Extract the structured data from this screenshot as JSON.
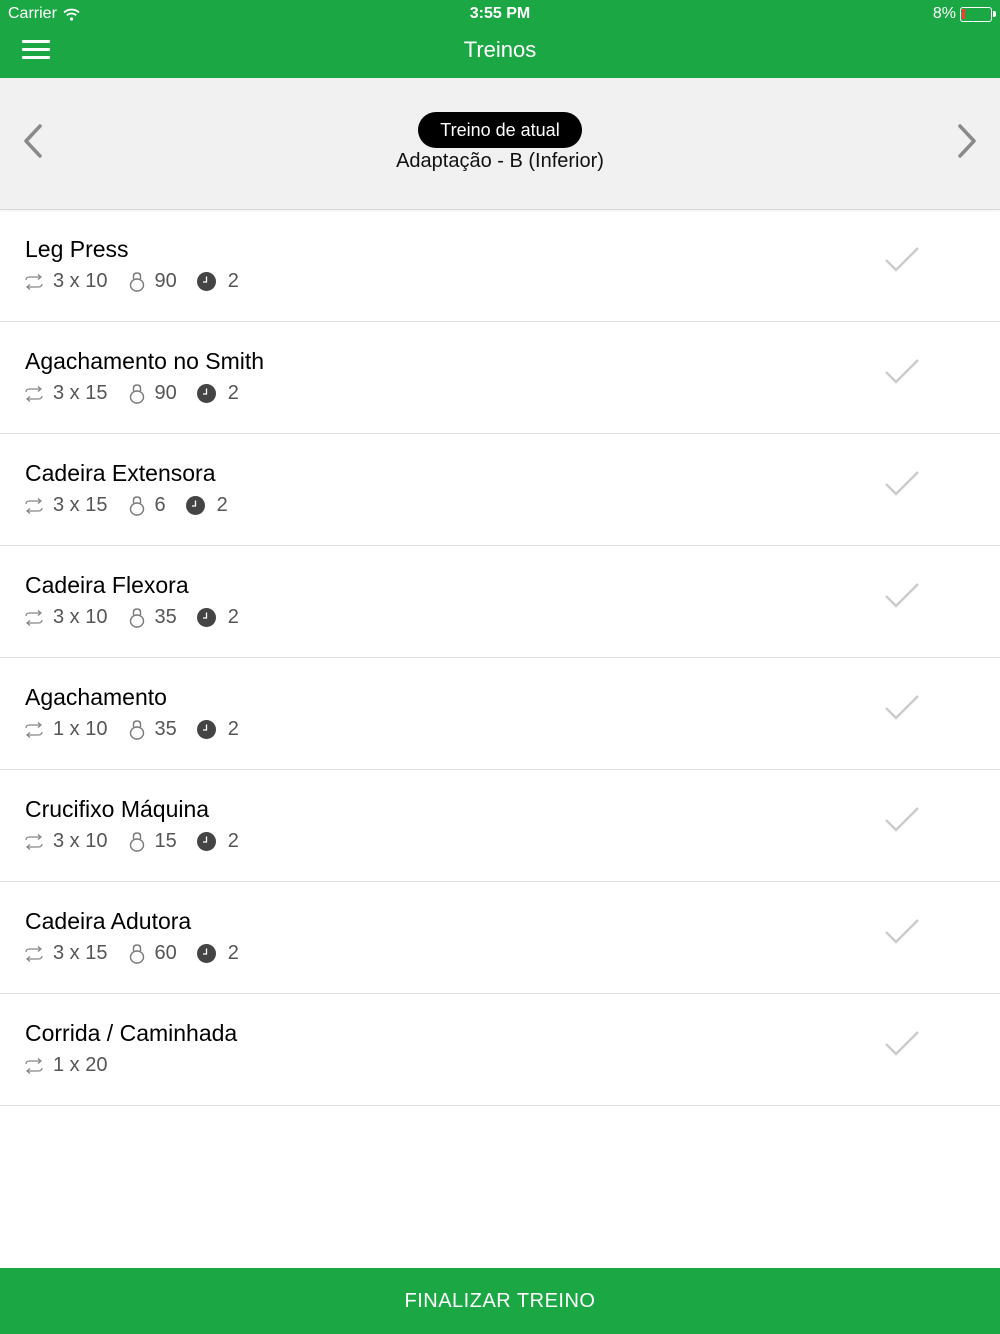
{
  "status_bar": {
    "carrier": "Carrier",
    "time": "3:55 PM",
    "battery": "8%"
  },
  "nav": {
    "title": "Treinos",
    "menu_icon": "hamburger-menu-icon"
  },
  "selector": {
    "badge": "Treino de atual",
    "workout": "Adaptação - B (Inferior)",
    "prev_icon": "chevron-left-icon",
    "next_icon": "chevron-right-icon"
  },
  "exercises": [
    {
      "name": "Leg Press",
      "sets": "3 x 10",
      "weight": "90",
      "rest": "2"
    },
    {
      "name": "Agachamento no Smith",
      "sets": "3 x 15",
      "weight": "90",
      "rest": "2"
    },
    {
      "name": "Cadeira Extensora",
      "sets": "3 x 15",
      "weight": "6",
      "rest": "2"
    },
    {
      "name": "Cadeira Flexora",
      "sets": "3 x 10",
      "weight": "35",
      "rest": "2"
    },
    {
      "name": "Agachamento",
      "sets": "1 x 10",
      "weight": "35",
      "rest": "2"
    },
    {
      "name": "Crucifixo Máquina",
      "sets": "3 x 10",
      "weight": "15",
      "rest": "2"
    },
    {
      "name": "Cadeira Adutora",
      "sets": "3 x 15",
      "weight": "60",
      "rest": "2"
    },
    {
      "name": "Corrida / Caminhada",
      "sets": "1 x 20"
    }
  ],
  "footer": {
    "finish_label": "FINALIZAR TREINO"
  },
  "colors": {
    "accent": "#1ba744",
    "selector_bg": "#f1f1f1",
    "check": "#cccccc"
  }
}
